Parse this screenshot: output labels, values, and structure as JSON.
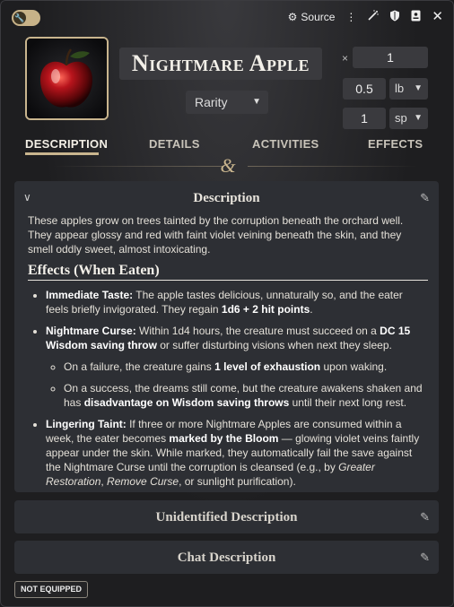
{
  "titlebar": {
    "source_label": "Source"
  },
  "item": {
    "name": "Nightmare Apple",
    "rarity": "Rarity",
    "quantity_prefix": "×",
    "quantity": "1",
    "weight_value": "0.5",
    "weight_unit": "lb",
    "price_value": "1",
    "price_unit": "sp"
  },
  "tabs": [
    {
      "label": "DESCRIPTION",
      "active": true
    },
    {
      "label": "DETAILS",
      "active": false
    },
    {
      "label": "ACTIVITIES",
      "active": false
    },
    {
      "label": "EFFECTS",
      "active": false
    }
  ],
  "description": {
    "title": "Description",
    "intro": "These apples grow on trees tainted by the corruption beneath the orchard well. They appear glossy and red with faint violet veining beneath the skin, and they smell oddly sweet, almost intoxicating.",
    "heading": "Effects (When Eaten)",
    "immediate_label": "Immediate Taste:",
    "immediate_text": " The apple tastes delicious, unnaturally so, and the eater feels briefly invigorated. They regain ",
    "immediate_bold": "1d6 + 2 hit points",
    "immediate_end": ".",
    "curse_label": "Nightmare Curse:",
    "curse_text1": " Within 1d4 hours, the creature must succeed on a ",
    "curse_bold": "DC 15 Wisdom saving throw",
    "curse_text2": " or suffer disturbing visions when next they sleep.",
    "fail_text1": "On a failure, the creature gains ",
    "fail_bold": "1 level of exhaustion",
    "fail_text2": " upon waking.",
    "success_text1": "On a success, the dreams still come, but the creature awakens shaken and has ",
    "success_bold": "disadvantage on Wisdom saving throws",
    "success_text2": " until their next long rest.",
    "taint_label": "Lingering Taint:",
    "taint_text1": " If three or more Nightmare Apples are consumed within a week, the eater becomes ",
    "taint_bold": "marked by the Bloom",
    "taint_text2": " — glowing violet veins faintly appear under the skin. While marked, they automatically fail the save against the Nightmare Curse until the corruption is cleansed (e.g., by ",
    "taint_italic1": "Greater Restoration",
    "taint_text3": ", ",
    "taint_italic2": "Remove Curse",
    "taint_text4": ", or sunlight purification)."
  },
  "sections": {
    "unidentified": "Unidentified Description",
    "chat": "Chat Description"
  },
  "status": {
    "equipped": "NOT EQUIPPED"
  },
  "colors": {
    "accent": "#c9b58e",
    "panel": "#2d2f34",
    "field": "#3a3a3e"
  }
}
